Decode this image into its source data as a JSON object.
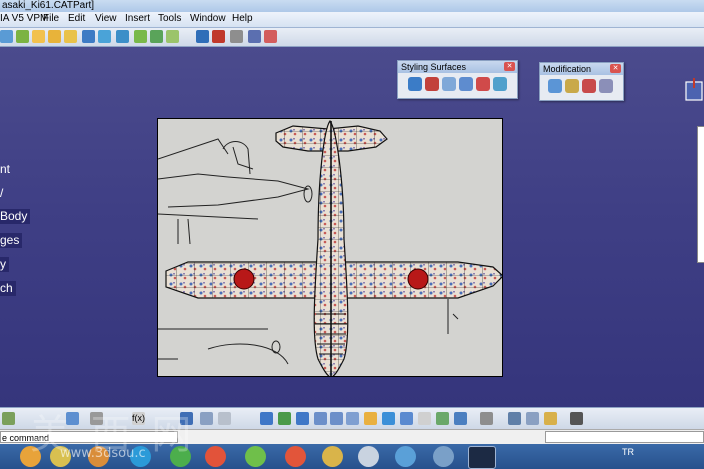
{
  "window": {
    "title": "asaki_Ki61.CATPart]"
  },
  "menu": {
    "app": "IA V5 VPM",
    "items": [
      "File",
      "Edit",
      "View",
      "Insert",
      "Tools",
      "Window",
      "Help"
    ]
  },
  "tree": {
    "items": [
      "nt",
      "/",
      "Body",
      "ges",
      "y",
      "ch"
    ]
  },
  "panels": {
    "styling": {
      "title": "Styling Surfaces"
    },
    "modification": {
      "title": "Modification"
    }
  },
  "statusbar": {
    "command_prompt": "e command"
  },
  "taskbar": {
    "tray_lang": "TR"
  },
  "watermark": {
    "chars": "美 西 网",
    "url": "www.3dsou.c"
  },
  "colors": {
    "viewport": "#3f3f85",
    "roundel": "#b81818",
    "titlebar": "#aec8e8"
  }
}
